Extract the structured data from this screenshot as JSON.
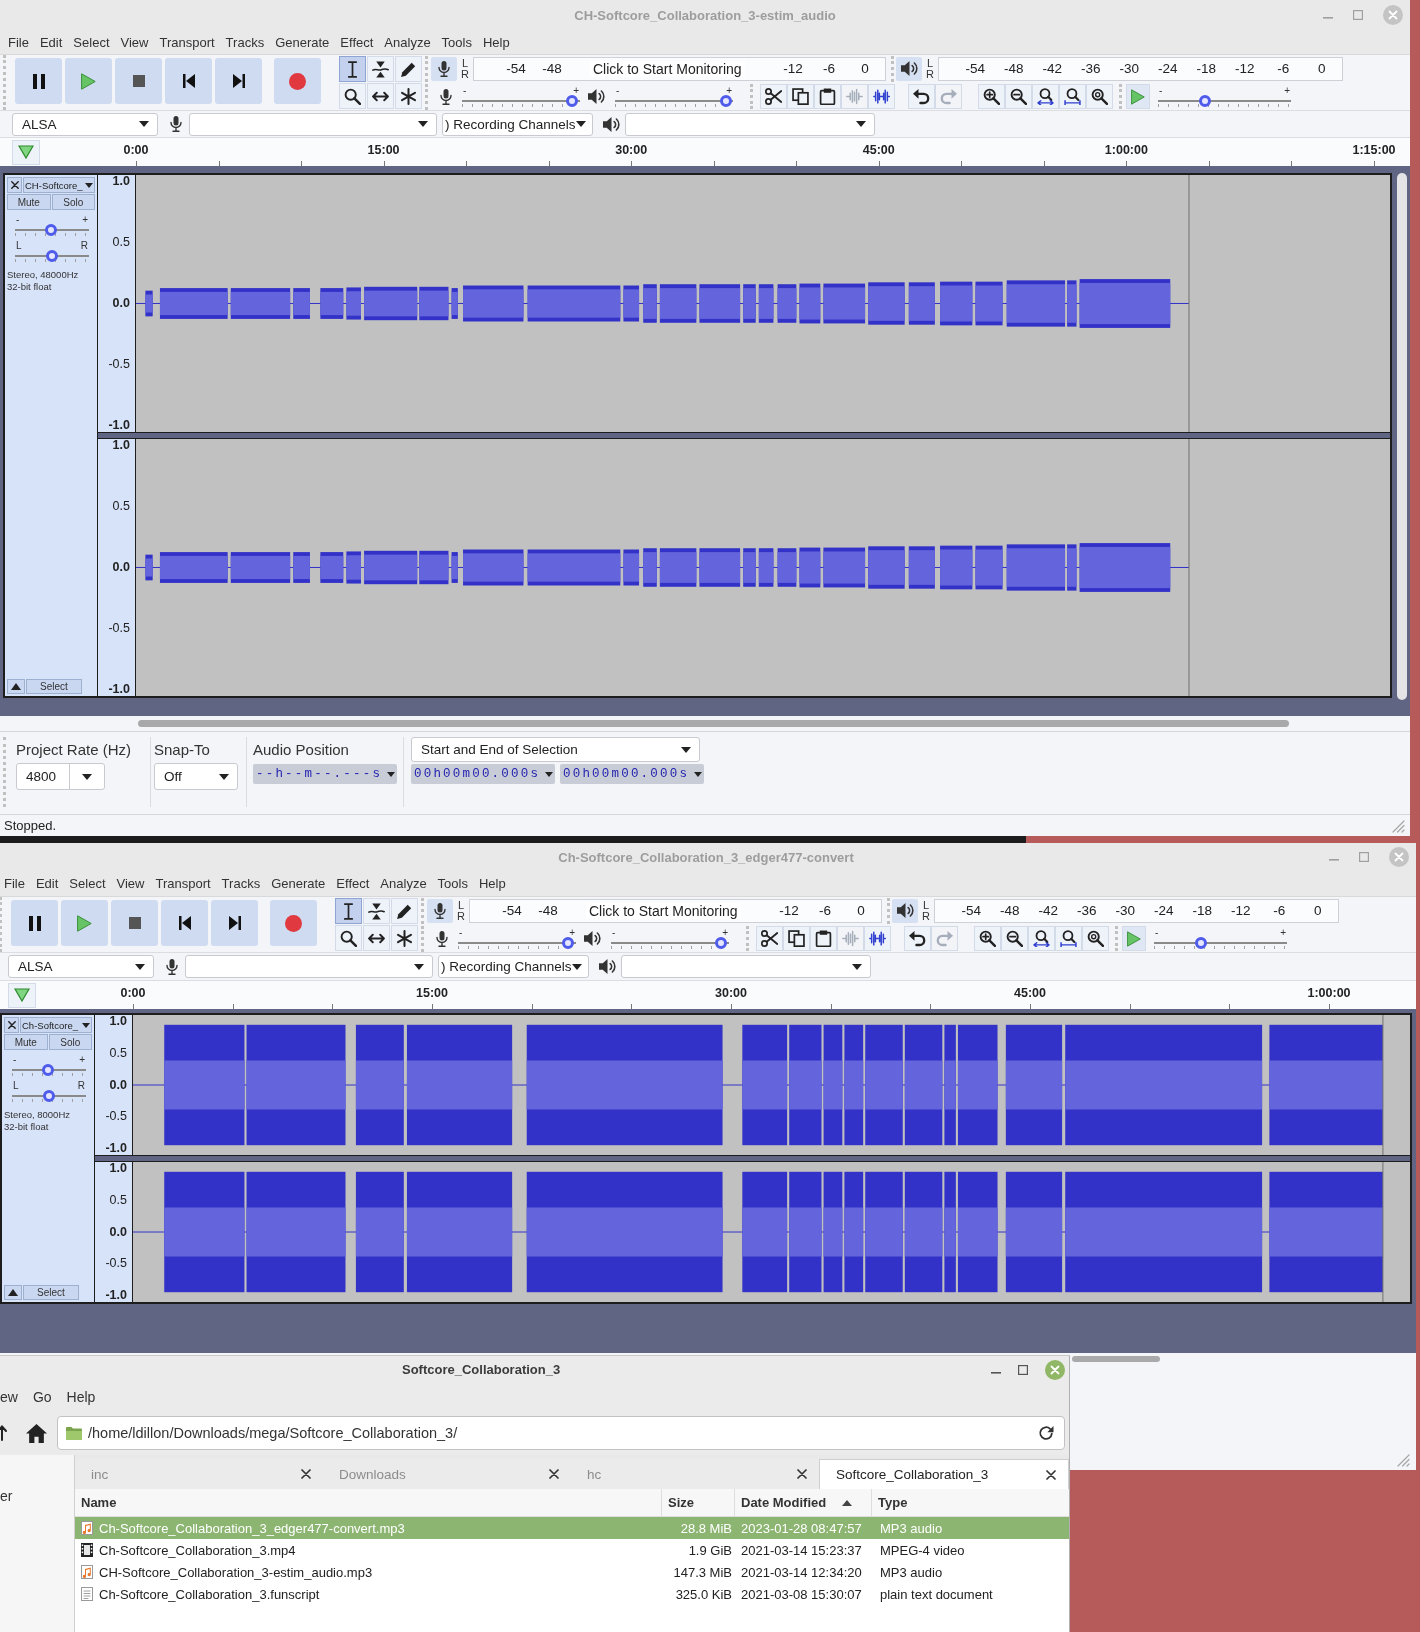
{
  "audacity_windows": [
    {
      "title": "CH-Softcore_Collaboration_3-estim_audio",
      "menu": [
        "File",
        "Edit",
        "Select",
        "View",
        "Transport",
        "Tracks",
        "Generate",
        "Effect",
        "Analyze",
        "Tools",
        "Help"
      ],
      "tools": [
        {
          "kind": "ibeam",
          "selected": true
        },
        {
          "kind": "envelope",
          "selected": false
        },
        {
          "kind": "pencil",
          "selected": false
        },
        {
          "kind": "zoom",
          "selected": false
        },
        {
          "kind": "shift",
          "selected": false
        },
        {
          "kind": "multi",
          "selected": false
        }
      ],
      "record_meter": {
        "channels": [
          "L",
          "R"
        ],
        "ticks_start": [
          "-54",
          "-48"
        ],
        "hint": "Click to Start Monitoring",
        "ticks_end": [
          "-12",
          "-6",
          "0"
        ]
      },
      "playback_meter": {
        "channels": [
          "L",
          "R"
        ],
        "ticks": [
          "-54",
          "-48",
          "-42",
          "-36",
          "-30",
          "-24",
          "-18",
          "-12",
          "-6",
          "0"
        ]
      },
      "recording_volume": {
        "min": "-",
        "max": "+",
        "level": 0.98
      },
      "playback_volume": {
        "min": "-",
        "max": "+",
        "level": 0.99
      },
      "edit_buttons": [
        {
          "kind": "cut",
          "disabled": false
        },
        {
          "kind": "copy",
          "disabled": false
        },
        {
          "kind": "paste",
          "disabled": false
        },
        {
          "kind": "trim",
          "disabled": true
        },
        {
          "kind": "silence",
          "disabled": false
        }
      ],
      "history_buttons": [
        {
          "kind": "undo",
          "disabled": false
        },
        {
          "kind": "redo",
          "disabled": true
        }
      ],
      "play_at_speed": {
        "min": "-",
        "max": "+",
        "level": 0.34
      },
      "host": "ALSA",
      "recording_channels": ") Recording Channels",
      "ruler": [
        "0:00",
        "15:00",
        "30:00",
        "45:00",
        "1:00:00",
        "1:15:00"
      ],
      "track": {
        "name": "CH-Softcore_",
        "mute": "Mute",
        "solo": "Solo",
        "gain": {
          "min": "-",
          "max": "+",
          "level": 0.48
        },
        "pan": {
          "min": "L",
          "max": "R",
          "level": 0.5
        },
        "info": [
          "Stereo, 48000Hz",
          "32-bit float"
        ],
        "select": "Select",
        "channels": [
          {
            "scale": [
              "1.0",
              "0.5",
              "0.0",
              "-0.5",
              "-1.0"
            ]
          },
          {
            "scale": [
              "1.0",
              "0.5",
              "0.0",
              "-0.5",
              "-1.0"
            ]
          }
        ]
      },
      "selection_toolbar": {
        "rate_label": "Project Rate (Hz)",
        "rate": "4800",
        "snap_label": "Snap-To",
        "snap": "Off",
        "position_label": "Audio Position",
        "position": "--h--m--.---s",
        "selection_mode": "Start and End of Selection",
        "selection_start": "00h00m00.000s",
        "selection_end": "00h00m00.000s"
      },
      "status": "Stopped."
    },
    {
      "title": "Ch-Softcore_Collaboration_3_edger477-convert",
      "menu": [
        "File",
        "Edit",
        "Select",
        "View",
        "Transport",
        "Tracks",
        "Generate",
        "Effect",
        "Analyze",
        "Tools",
        "Help"
      ],
      "tools": [
        {
          "kind": "ibeam",
          "selected": true
        },
        {
          "kind": "envelope",
          "selected": false
        },
        {
          "kind": "pencil",
          "selected": false
        },
        {
          "kind": "zoom",
          "selected": false
        },
        {
          "kind": "shift",
          "selected": false
        },
        {
          "kind": "multi",
          "selected": false
        }
      ],
      "record_meter": {
        "channels": [
          "L",
          "R"
        ],
        "ticks_start": [
          "-54",
          "-48"
        ],
        "hint": "Click to Start Monitoring",
        "ticks_end": [
          "-12",
          "-6",
          "0"
        ]
      },
      "playback_meter": {
        "channels": [
          "L",
          "R"
        ],
        "ticks": [
          "-54",
          "-48",
          "-42",
          "-36",
          "-30",
          "-24",
          "-18",
          "-12",
          "-6",
          "0"
        ]
      },
      "recording_volume": {
        "min": "-",
        "max": "+",
        "level": 0.98
      },
      "playback_volume": {
        "min": "-",
        "max": "+",
        "level": 0.98
      },
      "edit_buttons": [
        {
          "kind": "cut",
          "disabled": false
        },
        {
          "kind": "copy",
          "disabled": false
        },
        {
          "kind": "paste",
          "disabled": false
        },
        {
          "kind": "trim",
          "disabled": true
        },
        {
          "kind": "silence",
          "disabled": false
        }
      ],
      "history_buttons": [
        {
          "kind": "undo",
          "disabled": false
        },
        {
          "kind": "redo",
          "disabled": true
        }
      ],
      "play_at_speed": {
        "min": "-",
        "max": "+",
        "level": 0.34
      },
      "host": "ALSA",
      "recording_channels": ") Recording Channels",
      "ruler": [
        "0:00",
        "15:00",
        "30:00",
        "45:00",
        "1:00:00"
      ],
      "track": {
        "name": "Ch-Softcore_",
        "mute": "Mute",
        "solo": "Solo",
        "gain": {
          "min": "-",
          "max": "+",
          "level": 0.48
        },
        "pan": {
          "min": "L",
          "max": "R",
          "level": 0.5
        },
        "info": [
          "Stereo, 8000Hz",
          "32-bit float"
        ],
        "select": "Select",
        "channels": [
          {
            "scale": [
              "1.0",
              "0.5",
              "0.0",
              "-0.5",
              "-1.0"
            ]
          },
          {
            "scale": [
              "1.0",
              "0.5",
              "0.0",
              "-0.5",
              "-1.0"
            ]
          }
        ]
      }
    }
  ],
  "file_manager": {
    "title": "Softcore_Collaboration_3",
    "menu": [
      "ew",
      "Go",
      "Help"
    ],
    "path": "/home/ldillon/Downloads/mega/Softcore_Collaboration_3/",
    "sidebar": [
      "er"
    ],
    "tabs": [
      {
        "label": "inc",
        "selected": false
      },
      {
        "label": "Downloads",
        "selected": false
      },
      {
        "label": "hc",
        "selected": false
      },
      {
        "label": "Softcore_Collaboration_3",
        "selected": true
      }
    ],
    "columns": [
      {
        "label": "Name",
        "sorted": false
      },
      {
        "label": "Size",
        "sorted": false
      },
      {
        "label": "Date Modified",
        "sorted": true
      },
      {
        "label": "Type",
        "sorted": false
      }
    ],
    "rows": [
      {
        "kind": "audio",
        "name": "Ch-Softcore_Collaboration_3_edger477-convert.mp3",
        "size": "28.8 MiB",
        "modified": "2023-01-28 08:47:57",
        "type": "MP3 audio",
        "selected": true
      },
      {
        "kind": "video",
        "name": "Ch-Softcore_Collaboration_3.mp4",
        "size": "1.9 GiB",
        "modified": "2021-03-14 15:23:37",
        "type": "MPEG-4 video",
        "selected": false
      },
      {
        "kind": "audio",
        "name": "CH-Softcore_Collaboration_3-estim_audio.mp3",
        "size": "147.3 MiB",
        "modified": "2021-03-14 12:34:20",
        "type": "MP3 audio",
        "selected": false
      },
      {
        "kind": "text",
        "name": "Ch-Softcore_Collaboration_3.funscript",
        "size": "325.0 KiB",
        "modified": "2021-03-08 15:30:07",
        "type": "plain text document",
        "selected": false
      }
    ]
  }
}
